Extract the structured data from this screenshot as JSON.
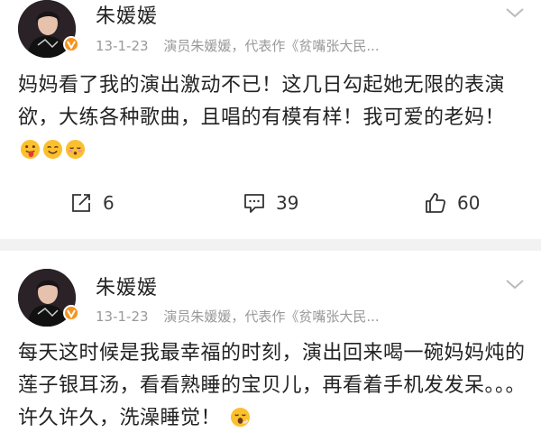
{
  "posts": [
    {
      "user_name": "朱媛媛",
      "time": "13-1-23",
      "source": "演员朱媛媛，代表作《贫嘴张大民...",
      "content": "妈妈看了我的演出激动不已！这几日勾起她无限的表演欲，大练各种歌曲，且唱的有模有样！我可爱的老妈！",
      "emojis": [
        "tongue-face-emoji",
        "smile-face-emoji",
        "blush-face-emoji"
      ],
      "repost_count": "6",
      "comment_count": "39",
      "like_count": "60"
    },
    {
      "user_name": "朱媛媛",
      "time": "13-1-23",
      "source": "演员朱媛媛，代表作《贫嘴张大民...",
      "content": "每天这时候是我最幸福的时刻，演出回来喝一碗妈妈炖的莲子银耳汤，看看熟睡的宝贝儿，再看着手机发发呆。。。许久许久，洗澡睡觉！",
      "emojis": [
        "yawn-face-emoji"
      ]
    }
  ],
  "colors": {
    "verified_badge": "#f7931e",
    "separator": "#f2f2f2",
    "meta_text": "#999999"
  }
}
